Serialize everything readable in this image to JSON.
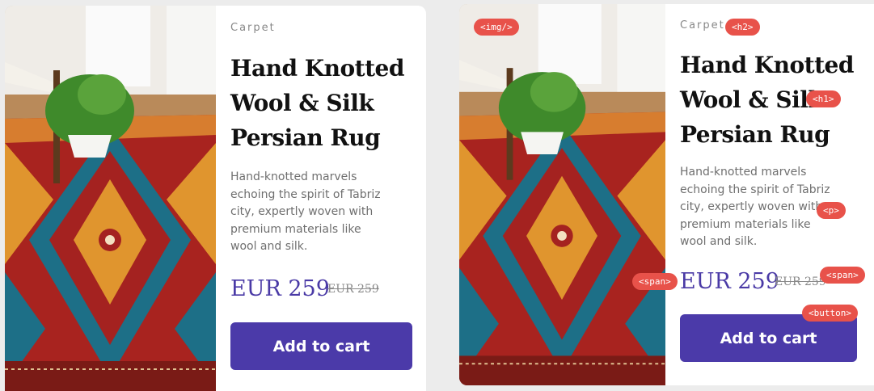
{
  "product": {
    "category": "Carpet",
    "title_lines": [
      "Hand Knotted",
      "Wool & Silk",
      "Persian Rug"
    ],
    "description_lines": [
      "Hand-knotted marvels",
      "echoing the spirit of Tabriz",
      "city, expertly woven with",
      "premium materials like",
      "wool and silk."
    ],
    "price": "EUR 259",
    "old_price": "EUR 259",
    "button_label": "Add to cart",
    "image_icon": "rug-photo"
  },
  "annotations": {
    "img": "<img/>",
    "h2": "<h2>",
    "h1": "<h1>",
    "p": "<p>",
    "span_price": "<span>",
    "span_old": "<span>",
    "button": "<button>"
  },
  "colors": {
    "accent": "#4b3aa9",
    "price": "#4a3aa6",
    "tag": "#e8524a"
  }
}
